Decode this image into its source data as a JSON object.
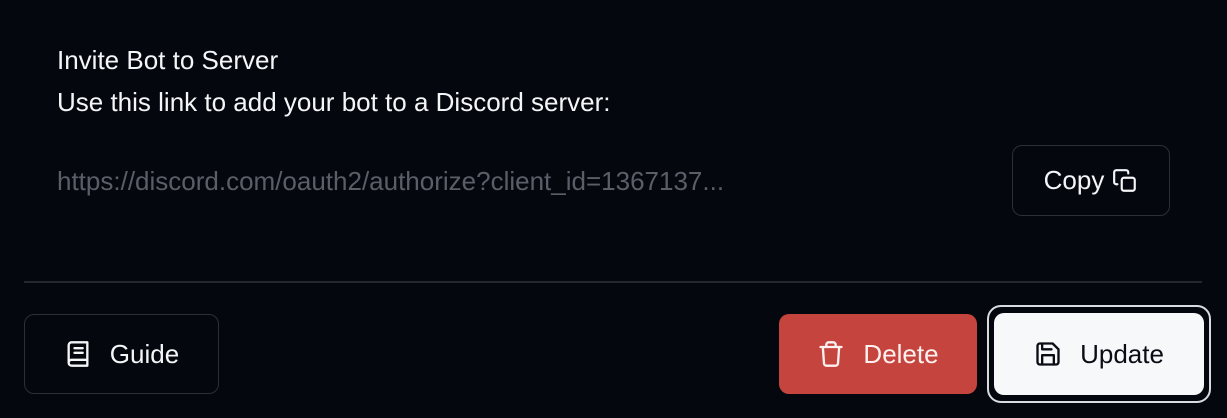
{
  "invite": {
    "title": "Invite Bot to Server",
    "description": "Use this link to add your bot to a Discord server:",
    "link": "https://discord.com/oauth2/authorize?client_id=1367137...",
    "copy_label": "Copy",
    "copy_icon": "copy-icon"
  },
  "footer": {
    "guide_label": "Guide",
    "guide_icon": "book-icon",
    "delete_label": "Delete",
    "delete_icon": "trash-icon",
    "update_label": "Update",
    "update_icon": "save-icon"
  },
  "colors": {
    "background": "#05070f",
    "delete": "#c5443e",
    "update": "#f7f8fa",
    "link_text": "#5a5e68"
  }
}
